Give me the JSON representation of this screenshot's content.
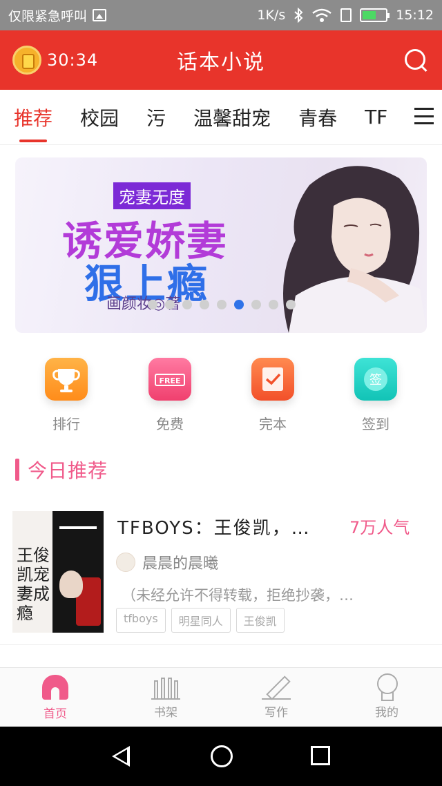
{
  "status_bar": {
    "carrier": "仅限紧急呼叫",
    "speed": "1K/s",
    "time": "15:12",
    "battery_level": 0.6,
    "icons": [
      "image-icon",
      "bluetooth-icon",
      "wifi-icon",
      "sim-icon",
      "battery-icon"
    ]
  },
  "header": {
    "timer": "30:34",
    "title": "话本小说",
    "icons": [
      "timer-icon",
      "search-icon"
    ]
  },
  "tabs": [
    "推荐",
    "校园",
    "污",
    "温馨甜宠",
    "青春",
    "TF"
  ],
  "active_tab": 0,
  "banner": {
    "tag": "宠妻无度",
    "title_line1": "诱爱娇妻",
    "title_line2": "狠上瘾",
    "author": "画颜妆◎著",
    "dot_count": 9,
    "active_dot": 5
  },
  "quick_menu": [
    {
      "label": "排行",
      "icon": "trophy-icon"
    },
    {
      "label": "免费",
      "icon": "free-icon",
      "icon_text": "FREE"
    },
    {
      "label": "完本",
      "icon": "check-icon"
    },
    {
      "label": "签到",
      "icon": "sign-icon",
      "icon_text": "签"
    }
  ],
  "section": {
    "title": "今日推荐"
  },
  "book": {
    "title": "TFBOYS：王俊凯，…",
    "popularity": "7万人气",
    "author": "晨晨的晨曦",
    "description": "（未经允许不得转载，拒绝抄袭，…",
    "tags": [
      "tfboys",
      "明星同人",
      "王俊凯"
    ],
    "cover_text": "王俊凯宠妻成瘾"
  },
  "bottom_nav": [
    {
      "label": "首页",
      "icon": "home-icon",
      "active": true
    },
    {
      "label": "书架",
      "icon": "bookshelf-icon",
      "active": false
    },
    {
      "label": "写作",
      "icon": "pen-icon",
      "active": false
    },
    {
      "label": "我的",
      "icon": "profile-icon",
      "active": false
    }
  ],
  "colors": {
    "header_bg": "#e8342b",
    "accent_pink": "#f05a8a",
    "active_dot": "#2f73e8"
  }
}
